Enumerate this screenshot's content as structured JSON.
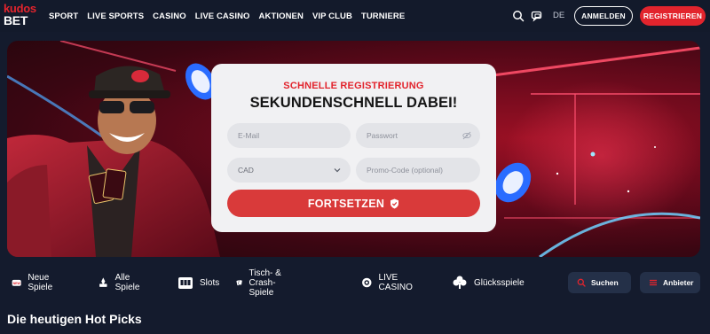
{
  "logo": {
    "line1": "kudos",
    "line2": "BET"
  },
  "nav": [
    "SPORT",
    "LIVE SPORTS",
    "CASINO",
    "LIVE CASINO",
    "AKTIONEN",
    "VIP CLUB",
    "TURNIERE"
  ],
  "header": {
    "language": "DE",
    "login_label": "ANMELDEN",
    "register_label": "REGISTRIEREN",
    "icons": [
      "search-icon",
      "chat-icon"
    ],
    "accent_color": "#e2242d"
  },
  "registration": {
    "subtitle": "SCHNELLE REGISTRIERUNG",
    "title": "SEKUNDENSCHNELL DABEI!",
    "email_placeholder": "E-Mail",
    "password_placeholder": "Passwort",
    "currency_value": "CAD",
    "promo_placeholder": "Promo-Code (optional)",
    "submit_label": "FORTSETZEN"
  },
  "categories": [
    {
      "label": "Neue Spiele",
      "icon": "new-games-icon"
    },
    {
      "label": "Alle Spiele",
      "icon": "all-games-icon"
    },
    {
      "label": "Slots",
      "icon": "slots-icon"
    },
    {
      "label": "Tisch- & Crash-Spiele",
      "icon": "cards-icon"
    },
    {
      "label": "LIVE CASINO",
      "icon": "live-casino-icon"
    },
    {
      "label": "Glücksspiele",
      "icon": "clover-icon"
    }
  ],
  "search_label": "Suchen",
  "providers_label": "Anbieter",
  "section_title": "Die heutigen Hot Picks"
}
